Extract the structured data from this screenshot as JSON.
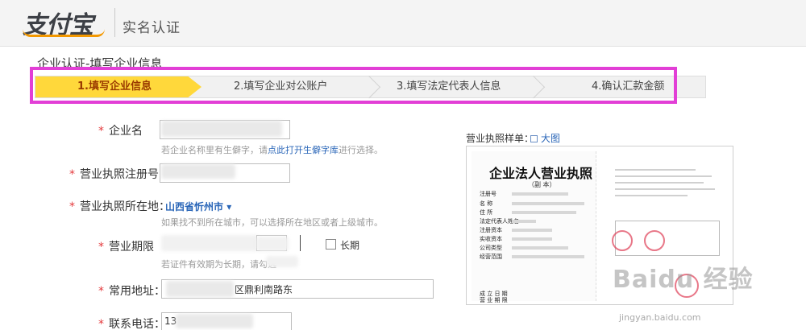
{
  "header": {
    "logo_text": "支付宝",
    "title": "实名认证"
  },
  "page": {
    "heading": "企业认证-填写企业信息"
  },
  "steps": [
    {
      "label": "1.填写企业信息",
      "active": true
    },
    {
      "label": "2.填写企业对公账户",
      "active": false
    },
    {
      "label": "3.填写法定代表人信息",
      "active": false
    },
    {
      "label": "4.确认汇款金额",
      "active": false
    }
  ],
  "form": {
    "company_name": {
      "label": "企业名",
      "hint_before": "若企业名称里有生僻字，请",
      "hint_link": "点此打开生僻字库",
      "hint_after": "进行选择。"
    },
    "license_number": {
      "label": "营业执照注册号："
    },
    "license_location": {
      "label": "营业执照所在地：",
      "value": "山西省忻州市",
      "hint": "如果找不到所在城市，可以选择所在地区或者上级城市。"
    },
    "business_term": {
      "label": "营业期限",
      "long_term_label": "长期",
      "hint": "若证件有效期为长期，请勾选"
    },
    "address": {
      "label": "常用地址：",
      "value_visible": "区鼎利南路东"
    },
    "phone": {
      "label": "联系电话：",
      "value_visible": "13"
    }
  },
  "sample": {
    "label": "营业执照样单：",
    "link": "大图",
    "document_title": "企业法人营业执照",
    "document_subtitle": "（副  本）",
    "fields": [
      "注册号",
      "名    称",
      "住    所",
      "法定代表人姓名",
      "注册资本",
      "实收资本",
      "公司类型",
      "经营范围"
    ],
    "footer_left": "成  立  日  期",
    "footer_right": "营  业  期  限"
  },
  "watermark": {
    "text": "Baidu 经验",
    "url": "jingyan.baidu.com"
  }
}
